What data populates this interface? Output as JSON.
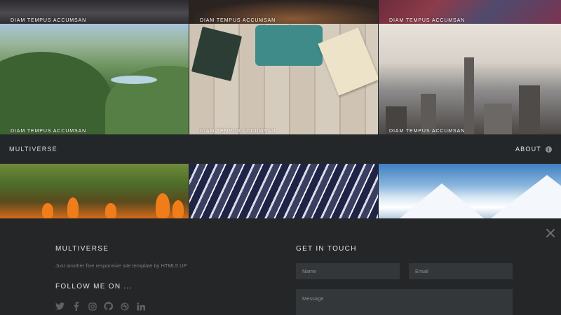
{
  "tiles": {
    "row1": [
      {
        "caption": "DIAM TEMPUS ACCUMSAN"
      },
      {
        "caption": "DIAM TEMPUS ACCUMSAN"
      },
      {
        "caption": "DIAM TEMPUS ACCUMSAN"
      }
    ],
    "row2": [
      {
        "caption": "DIAM TEMPUS ACCUMSAN"
      },
      {
        "caption": "DIAM TEMPUS ACCUMSAN"
      },
      {
        "caption": "DIAM TEMPUS ACCUMSAN"
      }
    ]
  },
  "header": {
    "brand": "MULTIVERSE",
    "about_label": "ABOUT",
    "about_icon": "info-icon"
  },
  "panel": {
    "title": "MULTIVERSE",
    "description": "Just another fine responsive site template by HTML5 UP",
    "follow_title": "FOLLOW ME ON ...",
    "socials": [
      "twitter-icon",
      "facebook-icon",
      "instagram-icon",
      "github-icon",
      "dribbble-icon",
      "linkedin-icon"
    ],
    "contact_title": "GET IN TOUCH",
    "name_placeholder": "Name",
    "email_placeholder": "Email",
    "message_placeholder": "Message",
    "close_icon": "close-icon"
  },
  "colors": {
    "background": "#1f2224",
    "header_bar": "#242729",
    "panel": "#242628",
    "field": "#33373a",
    "muted_text": "#7b7f82"
  }
}
